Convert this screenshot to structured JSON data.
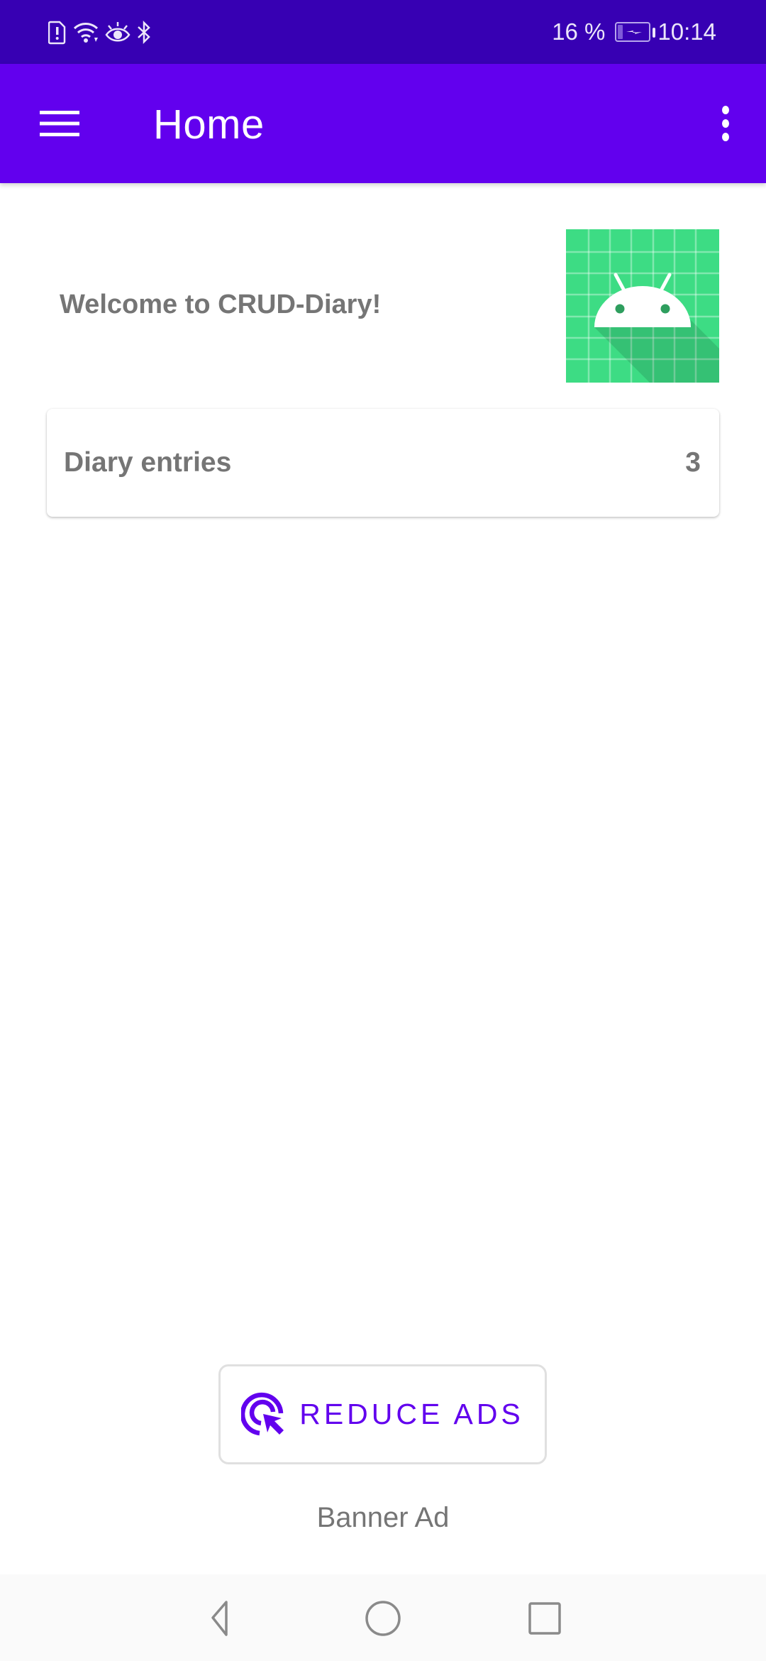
{
  "status_bar": {
    "icons_left": [
      "sim-alert-icon",
      "wifi-icon",
      "eye-comfort-icon",
      "bluetooth-icon"
    ],
    "battery_percent_text": "16 %",
    "battery_level": 0.16,
    "battery_charging": true,
    "time": "10:14"
  },
  "app_bar": {
    "title": "Home",
    "menu_icon": "hamburger-menu-icon",
    "overflow_icon": "more-vert-icon"
  },
  "main": {
    "welcome_text": "Welcome to CRUD-Diary!",
    "app_icon": "android-app-icon",
    "diary_card": {
      "label": "Diary entries",
      "count": "3"
    }
  },
  "ads": {
    "reduce_ads_label": "REDUCE ADS",
    "reduce_ads_icon": "ads-click-icon",
    "banner_label": "Banner Ad"
  },
  "nav_bar": {
    "buttons": [
      "back",
      "home",
      "recents"
    ]
  },
  "colors": {
    "status_bar": "#3700B3",
    "primary": "#6200EE",
    "text_secondary": "#757575",
    "icon_green": "#3DDC84"
  }
}
